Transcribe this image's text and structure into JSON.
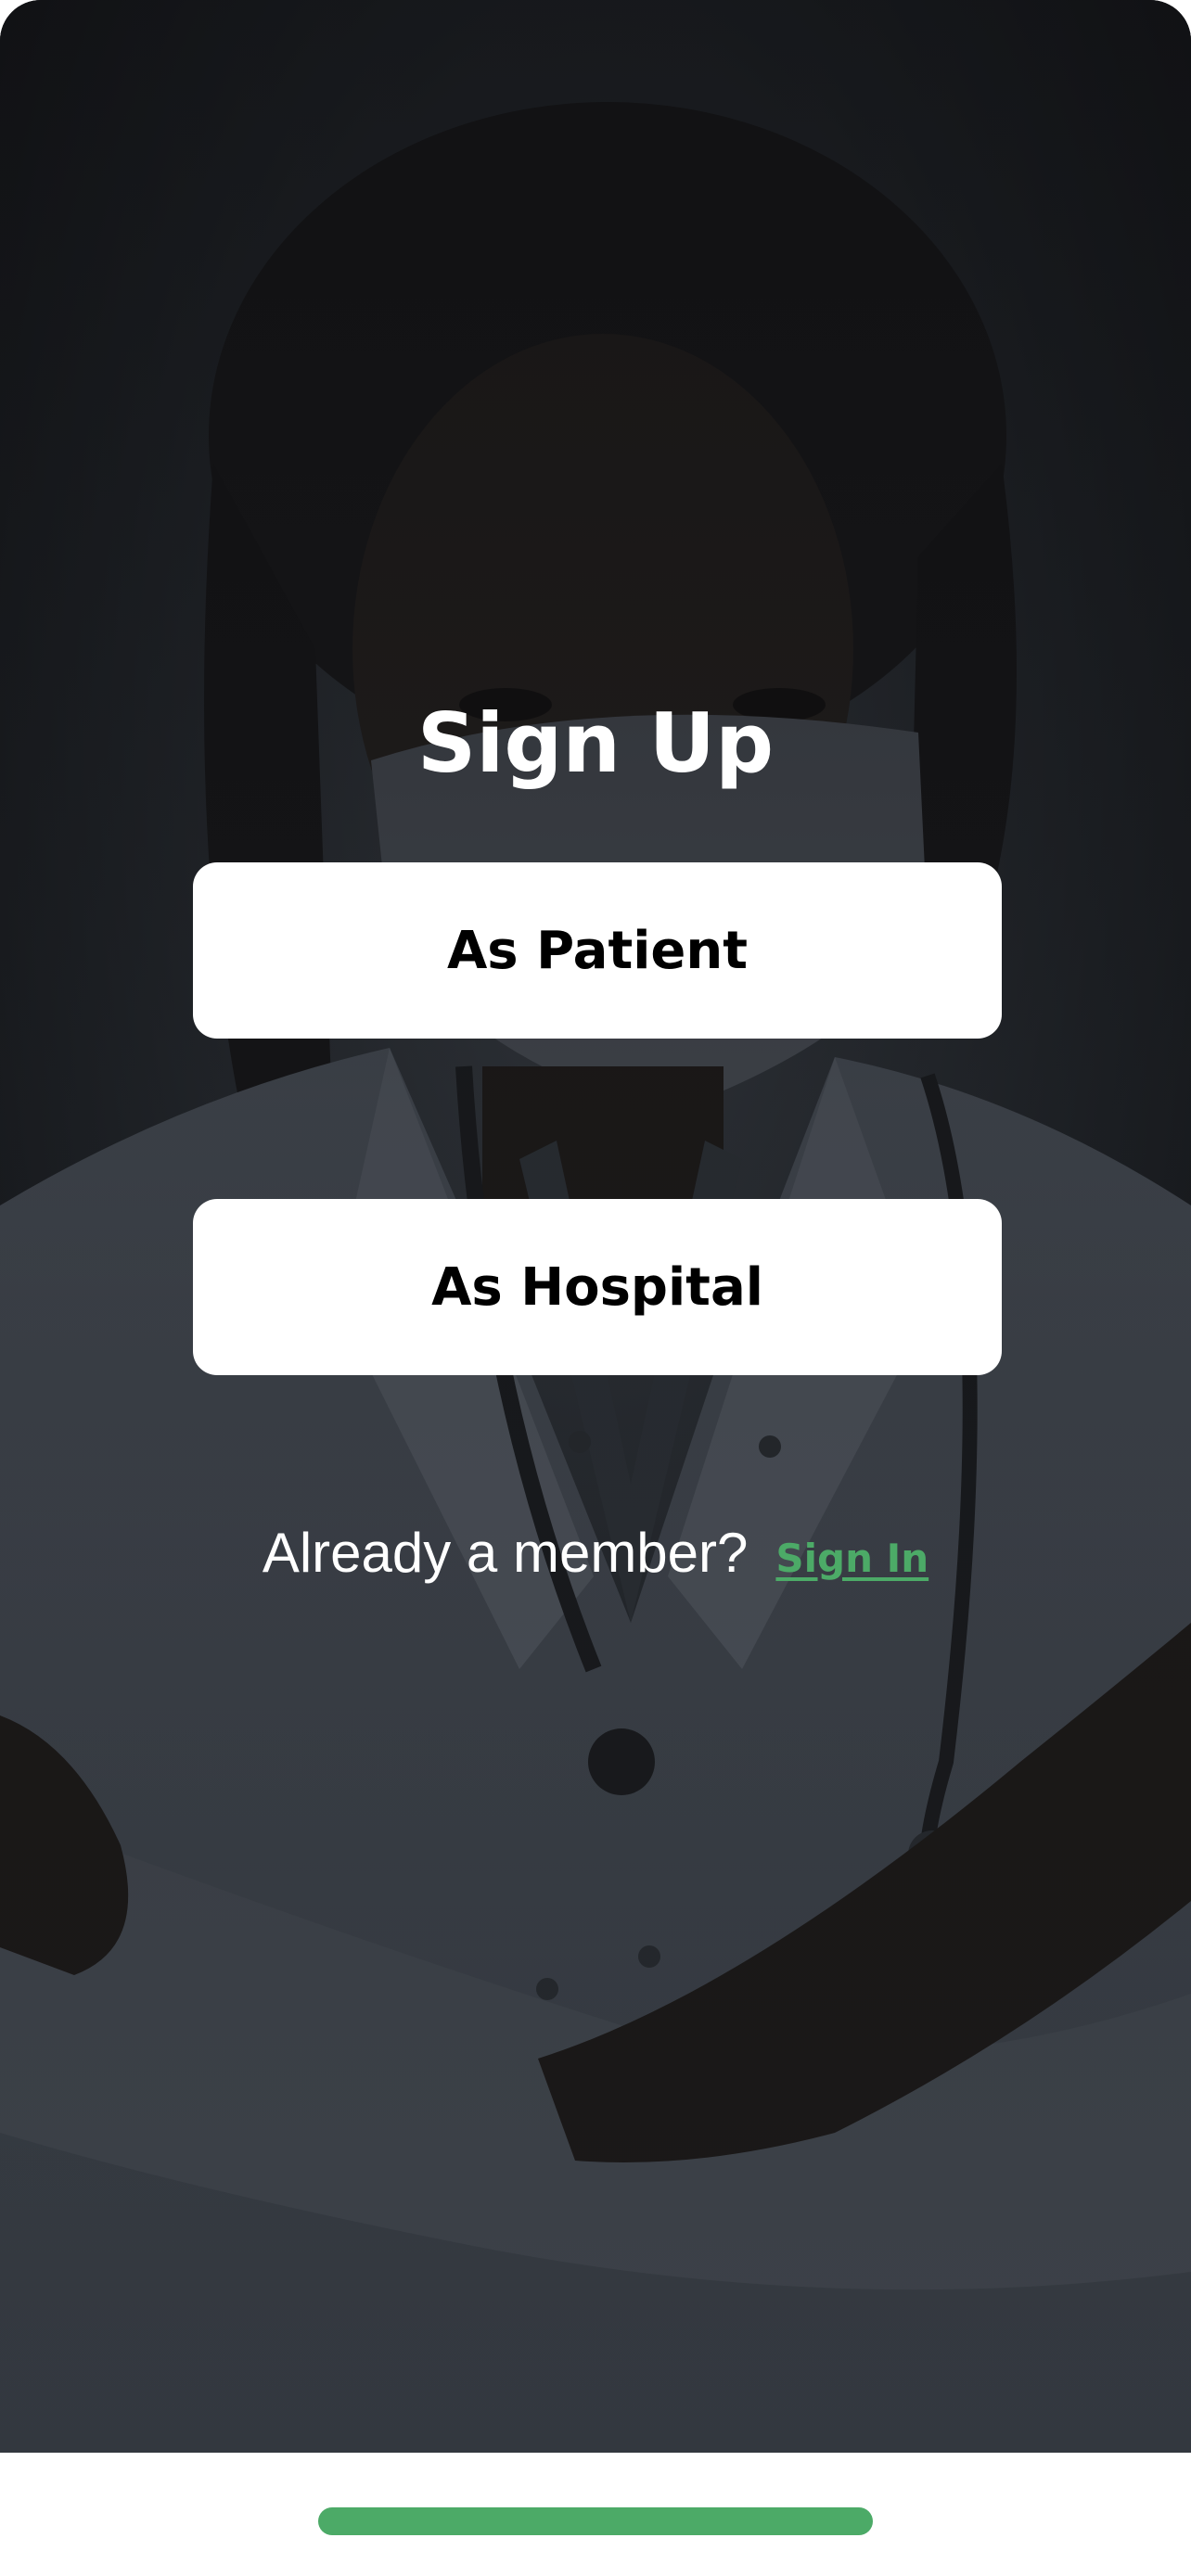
{
  "screen": {
    "title": "Sign Up"
  },
  "buttons": {
    "patient_label": "As Patient",
    "hospital_label": "As Hospital"
  },
  "footer": {
    "member_text": "Already a member?",
    "signin_label": "Sign In"
  },
  "colors": {
    "accent": "#4caa67",
    "button_bg": "#ffffff",
    "title_text": "#ffffff"
  },
  "icons": {
    "background": "doctor-portrait-image"
  }
}
